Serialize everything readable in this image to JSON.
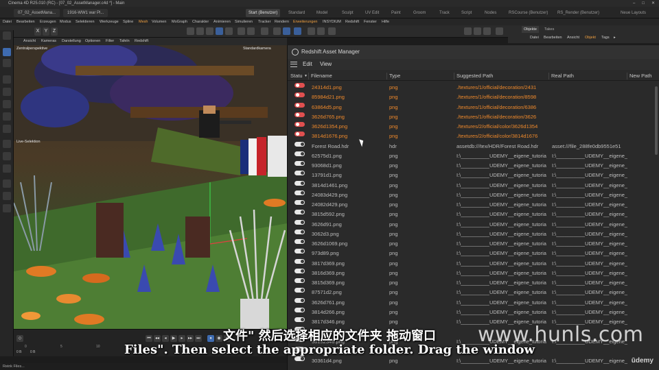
{
  "window": {
    "title": "Cinema 4D R25.010 (RC) - [07_02_AssetManager.c4d *] - Main",
    "controls": [
      "–",
      "□",
      "✕"
    ]
  },
  "tabs": {
    "documents": [
      "07_02_AssetMana...",
      "1916-WW1 war Pl..."
    ],
    "layouts": [
      "Start (Benutzer)",
      "Standard",
      "Model",
      "Sculpt",
      "UV Edit",
      "Paint",
      "Groom",
      "Track",
      "Script",
      "Nodes",
      "RSCourse (Benutzer)",
      "RS_Render (Benutzer)"
    ],
    "active_layout": 0,
    "new_layouts": "Neue Layouts"
  },
  "menubar": [
    "Datei",
    "Bearbeiten",
    "Erzeugen",
    "Modus",
    "Selektieren",
    "Werkzeuge",
    "Spline",
    "Mesh",
    "Volumen",
    "MoGraph",
    "Charakter",
    "Animieren",
    "Simulieren",
    "Tracker",
    "Rendern",
    "Erweiterungen",
    "INSYDIUM",
    "Redshift",
    "Fenster",
    "Hilfe"
  ],
  "toolbar": {
    "axes": [
      "X",
      "Y",
      "Z"
    ]
  },
  "viewport": {
    "menu": [
      "Ansicht",
      "Kameras",
      "Darstellung",
      "Optionen",
      "Filter",
      "Tafeln",
      "Redshift"
    ],
    "label_left": "Zentralperspektive",
    "label_right": "Standardkamera",
    "live_selection": "Live-Selektion"
  },
  "timeline": {
    "ruler": [
      "0",
      "5",
      "10",
      "15"
    ],
    "frame_start": "0 B",
    "frame_current": "0 B"
  },
  "status": "Reink Files...",
  "object_manager": {
    "tabs": [
      "Objekte",
      "Takes"
    ],
    "active_tab": 0,
    "menu": [
      "Datei",
      "Bearbeiten",
      "Ansicht",
      "Objekt",
      "Tags",
      "▸"
    ]
  },
  "asset_manager": {
    "title": "Redshift Asset Manager",
    "menu": [
      "Edit",
      "View"
    ],
    "columns": [
      "Statu",
      "Filename",
      "Type",
      "Suggested Path",
      "Real Path",
      "New Path"
    ],
    "rows": [
      {
        "status": "missing",
        "filename": "24314d1.png",
        "type": "png",
        "suggested": "./textures/1/official/decoration/2431",
        "real": ""
      },
      {
        "status": "missing",
        "filename": "85984d21.png",
        "type": "png",
        "suggested": "./textures/1/official/decoration/8598",
        "real": ""
      },
      {
        "status": "missing",
        "filename": "63864d5.png",
        "type": "png",
        "suggested": "./textures/1/official/decoration/6386",
        "real": ""
      },
      {
        "status": "missing",
        "filename": "3626d765.png",
        "type": "png",
        "suggested": "./textures/1/official/decoration/3626",
        "real": ""
      },
      {
        "status": "missing",
        "filename": "3626d1354.png",
        "type": "png",
        "suggested": "./textures/2/official/color/3626d1354",
        "real": ""
      },
      {
        "status": "missing",
        "filename": "3814d1676.png",
        "type": "png",
        "suggested": "./textures/2/official/color/3814d1676",
        "real": ""
      },
      {
        "status": "ok",
        "filename": "Forest Road.hdr",
        "type": "hdr",
        "suggested": "assetdb:///tex/HDR/Forest Road.hdr",
        "real": "asset:///file_288fe0db9551e51"
      },
      {
        "status": "ok",
        "filename": "62575d1.png",
        "type": "png",
        "suggested": "I:\\__________UDEMY__eigene_tutoria",
        "real": "I:\\__________UDEMY__eigene_"
      },
      {
        "status": "ok",
        "filename": "93068d1.png",
        "type": "png",
        "suggested": "I:\\__________UDEMY__eigene_tutoria",
        "real": "I:\\__________UDEMY__eigene_"
      },
      {
        "status": "ok",
        "filename": "13791d1.png",
        "type": "png",
        "suggested": "I:\\__________UDEMY__eigene_tutoria",
        "real": "I:\\__________UDEMY__eigene_"
      },
      {
        "status": "ok",
        "filename": "3814d1461.png",
        "type": "png",
        "suggested": "I:\\__________UDEMY__eigene_tutoria",
        "real": "I:\\__________UDEMY__eigene_"
      },
      {
        "status": "ok",
        "filename": "24083d429.png",
        "type": "png",
        "suggested": "I:\\__________UDEMY__eigene_tutoria",
        "real": "I:\\__________UDEMY__eigene_"
      },
      {
        "status": "ok",
        "filename": "24082d429.png",
        "type": "png",
        "suggested": "I:\\__________UDEMY__eigene_tutoria",
        "real": "I:\\__________UDEMY__eigene_"
      },
      {
        "status": "ok",
        "filename": "3815d592.png",
        "type": "png",
        "suggested": "I:\\__________UDEMY__eigene_tutoria",
        "real": "I:\\__________UDEMY__eigene_"
      },
      {
        "status": "ok",
        "filename": "3626d91.png",
        "type": "png",
        "suggested": "I:\\__________UDEMY__eigene_tutoria",
        "real": "I:\\__________UDEMY__eigene_"
      },
      {
        "status": "ok",
        "filename": "3062d3.png",
        "type": "png",
        "suggested": "I:\\__________UDEMY__eigene_tutoria",
        "real": "I:\\__________UDEMY__eigene_"
      },
      {
        "status": "ok",
        "filename": "3626d1069.png",
        "type": "png",
        "suggested": "I:\\__________UDEMY__eigene_tutoria",
        "real": "I:\\__________UDEMY__eigene_"
      },
      {
        "status": "ok",
        "filename": "973d89.png",
        "type": "png",
        "suggested": "I:\\__________UDEMY__eigene_tutoria",
        "real": "I:\\__________UDEMY__eigene_"
      },
      {
        "status": "ok",
        "filename": "3817d369.png",
        "type": "png",
        "suggested": "I:\\__________UDEMY__eigene_tutoria",
        "real": "I:\\__________UDEMY__eigene_"
      },
      {
        "status": "ok",
        "filename": "3816d369.png",
        "type": "png",
        "suggested": "I:\\__________UDEMY__eigene_tutoria",
        "real": "I:\\__________UDEMY__eigene_"
      },
      {
        "status": "ok",
        "filename": "3815d369.png",
        "type": "png",
        "suggested": "I:\\__________UDEMY__eigene_tutoria",
        "real": "I:\\__________UDEMY__eigene_"
      },
      {
        "status": "ok",
        "filename": "87571d2.png",
        "type": "png",
        "suggested": "I:\\__________UDEMY__eigene_tutoria",
        "real": "I:\\__________UDEMY__eigene_"
      },
      {
        "status": "ok",
        "filename": "3626d761.png",
        "type": "png",
        "suggested": "I:\\__________UDEMY__eigene_tutoria",
        "real": "I:\\__________UDEMY__eigene_"
      },
      {
        "status": "ok",
        "filename": "3814d266.png",
        "type": "png",
        "suggested": "I:\\__________UDEMY__eigene_tutoria",
        "real": "I:\\__________UDEMY__eigene_"
      },
      {
        "status": "ok",
        "filename": "3817d346.png",
        "type": "png",
        "suggested": "I:\\__________UDEMY__eigene_tutoria",
        "real": "I:\\__________UDEMY__eigene_"
      },
      {
        "status": "ok",
        "filename": "",
        "type": "",
        "suggested": "",
        "real": ""
      },
      {
        "status": "ok",
        "filename": "38152346.png",
        "type": "png",
        "suggested": "I:\\__________UDEMY__eigene_tutoria",
        "real": "I:\\__________UDEMY__eigene_"
      },
      {
        "status": "ok",
        "filename": "",
        "type": "",
        "suggested": "",
        "real": ""
      },
      {
        "status": "ok",
        "filename": "30361d4.png",
        "type": "png",
        "suggested": "I:\\__________UDEMY__eigene_tutoria",
        "real": "I:\\__________UDEMY__eigene_"
      }
    ]
  },
  "subtitles": {
    "chinese": "文件\" 然后选择相应的文件夹 拖动窗口",
    "english": "Files\". Then select the appropriate folder. Drag the window"
  },
  "watermark": "www.hunls.com",
  "brand": "ūdemy"
}
